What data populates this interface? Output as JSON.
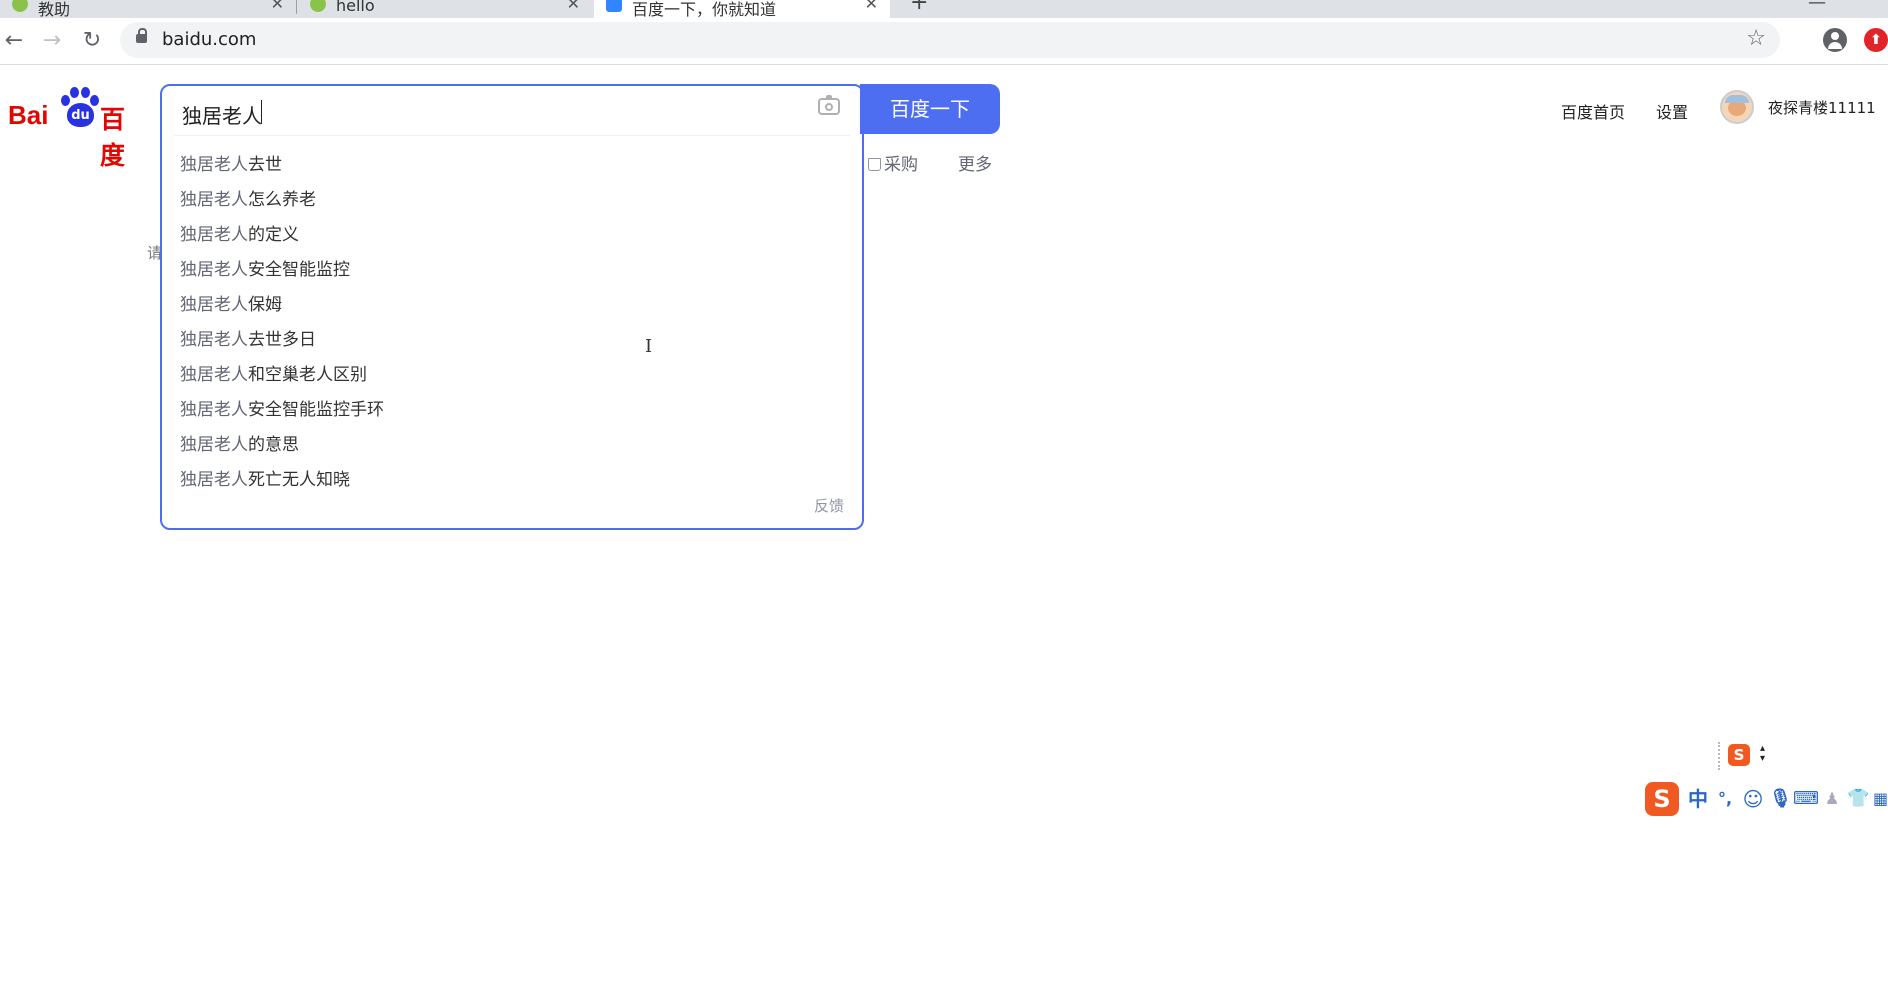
{
  "browser": {
    "tabs": [
      {
        "title": "教助",
        "active": false
      },
      {
        "title": "hello",
        "active": false
      },
      {
        "title": "百度一下，你就知道",
        "active": true
      }
    ],
    "new_tab_label": "+",
    "url": "baidu.com"
  },
  "baidu": {
    "logo_text_latin": "Bai",
    "logo_text_du": "du",
    "logo_text_cn": "百度",
    "search": {
      "query": "独居老人",
      "button_label": "百度一下",
      "suggestions": [
        {
          "prefix": "独居老人",
          "suffix": "去世"
        },
        {
          "prefix": "独居老人",
          "suffix": "怎么养老"
        },
        {
          "prefix": "独居老人",
          "suffix": "的定义"
        },
        {
          "prefix": "独居老人",
          "suffix": "安全智能监控"
        },
        {
          "prefix": "独居老人",
          "suffix": "保姆"
        },
        {
          "prefix": "独居老人",
          "suffix": "去世多日"
        },
        {
          "prefix": "独居老人",
          "suffix": "和空巢老人区别"
        },
        {
          "prefix": "独居老人",
          "suffix": "安全智能监控手环"
        },
        {
          "prefix": "独居老人",
          "suffix": "的意思"
        },
        {
          "prefix": "独居老人",
          "suffix": "死亡无人知晓"
        }
      ],
      "feedback_label": "反馈"
    },
    "nav_peek": {
      "purchase": "采购",
      "more": "更多"
    },
    "behind_text": "请",
    "top_right": {
      "home": "百度首页",
      "settings": "设置",
      "username": "夜探青楼11111"
    }
  },
  "ime": {
    "logo": "S",
    "chinese_mode": "中",
    "punct": "°,"
  },
  "colors": {
    "brand_blue": "#4e6ef2",
    "logo_red": "#e10602",
    "logo_blue": "#2932e1",
    "ime_orange": "#f05a22"
  }
}
